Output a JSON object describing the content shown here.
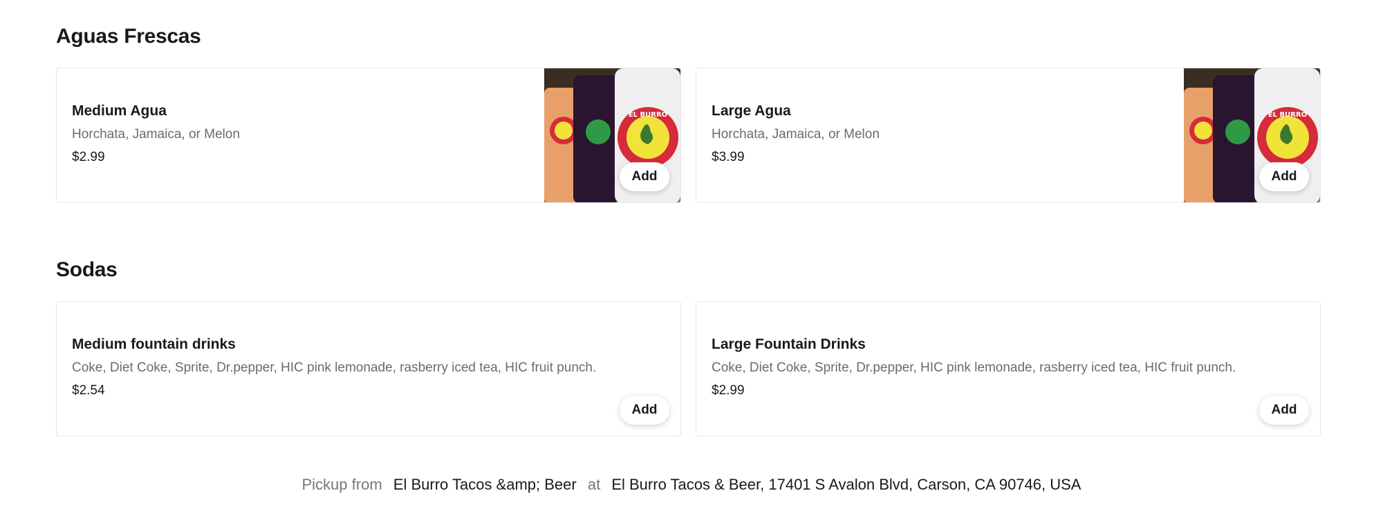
{
  "sections": [
    {
      "title": "Aguas Frescas",
      "items": [
        {
          "name": "Medium Agua",
          "description": "Horchata, Jamaica, or Melon",
          "price": "$2.99",
          "add_label": "Add"
        },
        {
          "name": "Large Agua",
          "description": "Horchata, Jamaica, or Melon",
          "price": "$3.99",
          "add_label": "Add"
        }
      ]
    },
    {
      "title": "Sodas",
      "items": [
        {
          "name": "Medium fountain drinks",
          "description": "Coke, Diet Coke, Sprite, Dr.pepper, HIC pink lemonade, rasberry iced tea, HIC fruit punch.",
          "price": "$2.54",
          "add_label": "Add"
        },
        {
          "name": "Large Fountain Drinks",
          "description": "Coke, Diet Coke, Sprite, Dr.pepper, HIC pink lemonade, rasberry iced tea, HIC fruit punch.",
          "price": "$2.99",
          "add_label": "Add"
        }
      ]
    }
  ],
  "footer": {
    "pickup_label": "Pickup from",
    "restaurant": "El Burro Tacos &amp; Beer",
    "at_label": "at",
    "address": "El Burro Tacos & Beer, 17401 S Avalon Blvd, Carson, CA 90746, USA"
  },
  "product_image_text": "EL BURRO",
  "colors": {
    "text_primary": "#191919",
    "text_secondary": "#6b6b6b",
    "card_border": "#e7e7e7",
    "logo_red": "#d62b3a",
    "logo_yellow": "#f2e33b"
  }
}
